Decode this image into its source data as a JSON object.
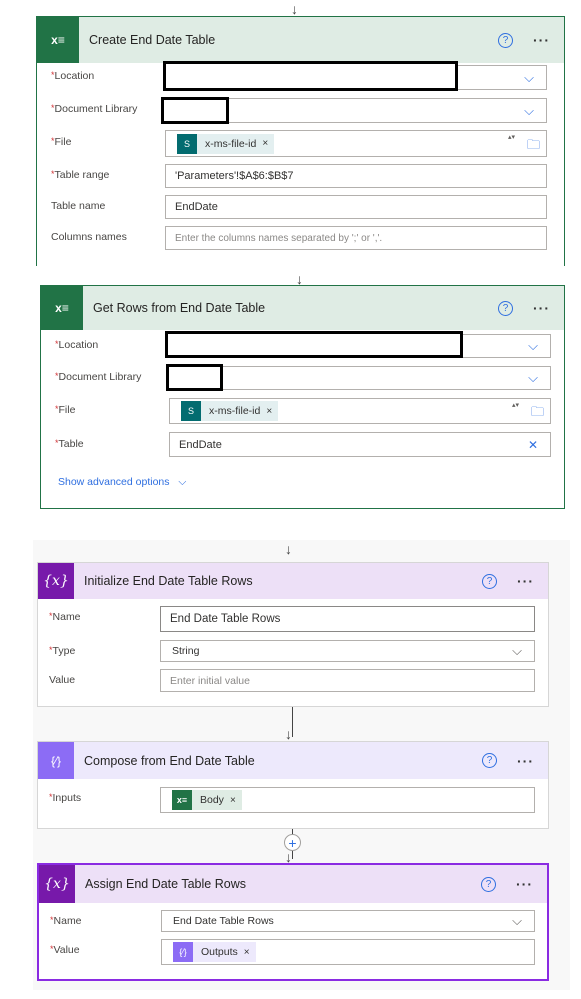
{
  "colors": {
    "excel": "#217346",
    "variable": "#7719aa",
    "compose": "#8c6cf5",
    "link": "#2f6fe0",
    "required": "#d13438"
  },
  "cards": [
    {
      "title": "Create End Date Table",
      "icon": "excel-icon",
      "fields": [
        {
          "label": "Location",
          "required": true,
          "type": "dropdown",
          "value": ""
        },
        {
          "label": "Document Library",
          "required": true,
          "type": "dropdown",
          "value": ""
        },
        {
          "label": "File",
          "required": true,
          "type": "token",
          "token": "x-ms-file-id"
        },
        {
          "label": "Table range",
          "required": true,
          "type": "text",
          "value": "'Parameters'!$A$6:$B$7"
        },
        {
          "label": "Table name",
          "required": false,
          "type": "text",
          "value": "EndDate"
        },
        {
          "label": "Columns names",
          "required": false,
          "type": "text",
          "placeholder": "Enter the columns names separated by ';' or ','."
        }
      ]
    },
    {
      "title": "Get Rows from End Date Table",
      "icon": "excel-icon",
      "fields": [
        {
          "label": "Location",
          "required": true,
          "type": "dropdown",
          "value": ""
        },
        {
          "label": "Document Library",
          "required": true,
          "type": "dropdown",
          "value": ""
        },
        {
          "label": "File",
          "required": true,
          "type": "token",
          "token": "x-ms-file-id"
        },
        {
          "label": "Table",
          "required": true,
          "type": "text",
          "value": "EndDate"
        }
      ],
      "advanced": "Show advanced options"
    },
    {
      "title": "Initialize End Date Table Rows",
      "icon": "variable-icon",
      "fields": [
        {
          "label": "Name",
          "required": true,
          "value": "End Date Table Rows"
        },
        {
          "label": "Type",
          "required": true,
          "value": "String"
        },
        {
          "label": "Value",
          "required": false,
          "placeholder": "Enter initial value"
        }
      ]
    },
    {
      "title": "Compose from End Date Table",
      "icon": "compose-icon",
      "fields": [
        {
          "label": "Inputs",
          "required": true,
          "token": "Body"
        }
      ]
    },
    {
      "title": "Assign End Date Table Rows",
      "icon": "variable-icon",
      "fields": [
        {
          "label": "Name",
          "required": true,
          "value": "End Date Table Rows"
        },
        {
          "label": "Value",
          "required": true,
          "token": "Outputs"
        }
      ]
    }
  ],
  "glyphs": {
    "help": "?",
    "more": "···",
    "chevron": "⌵",
    "close": "×",
    "star": "*",
    "excel": "x≡",
    "variable": "{x}",
    "compose": "{⁄}",
    "plus": "+",
    "spinner": "▴▾",
    "folder": "🗀",
    "clear": "✕",
    "arrow": "↓"
  }
}
